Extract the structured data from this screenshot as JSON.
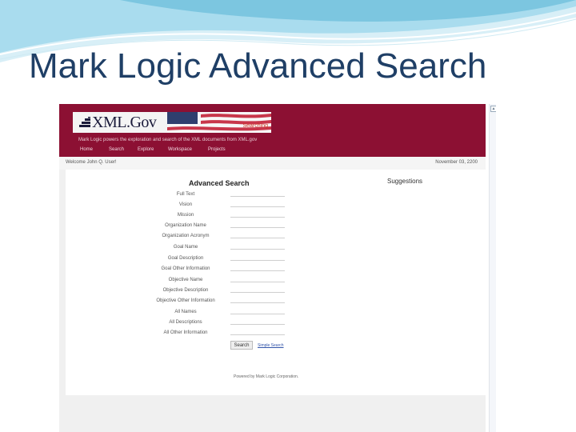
{
  "slide": {
    "title": "Mark Logic Advanced Search"
  },
  "browser": {
    "logo_text": "XML.Gov",
    "flag_note": "Searching",
    "tagline": "Mark Logic powers the exploration and search of the XML documents from XML.gov",
    "nav": [
      "Home",
      "Search",
      "Explore",
      "Workspace",
      "Projects"
    ],
    "user_welcome": "Welcome John Q. User!",
    "date": "November 03, 2200",
    "suggestions_label": "Suggestions",
    "footer": "Powered by Mark Logic Corporation."
  },
  "form": {
    "title": "Advanced Search",
    "fields": [
      {
        "label": "Full Text",
        "value": ""
      },
      {
        "label": "Vision",
        "value": ""
      },
      {
        "label": "Mission",
        "value": ""
      },
      {
        "label": "Organization Name",
        "value": ""
      },
      {
        "label": "Organization Acronym",
        "value": ""
      },
      {
        "label": "Goal Name",
        "value": ""
      },
      {
        "label": "Goal Description",
        "value": ""
      },
      {
        "label": "Goal Other Information",
        "value": ""
      },
      {
        "label": "Objective Name",
        "value": ""
      },
      {
        "label": "Objective Description",
        "value": ""
      },
      {
        "label": "Objective Other Information",
        "value": ""
      },
      {
        "label": "All Names",
        "value": ""
      },
      {
        "label": "All Descriptions",
        "value": ""
      },
      {
        "label": "All Other Information",
        "value": ""
      }
    ],
    "search_label": "Search",
    "simple_search_link": "Simple Search"
  },
  "colors": {
    "header": "#8c1033",
    "title": "#1f3f66",
    "wave": "#7cc6e0"
  },
  "icons": {
    "logo": "xml-gov-logo-icon",
    "flag": "us-flag-icon",
    "scroll_up": "scroll-up-arrow-icon"
  }
}
